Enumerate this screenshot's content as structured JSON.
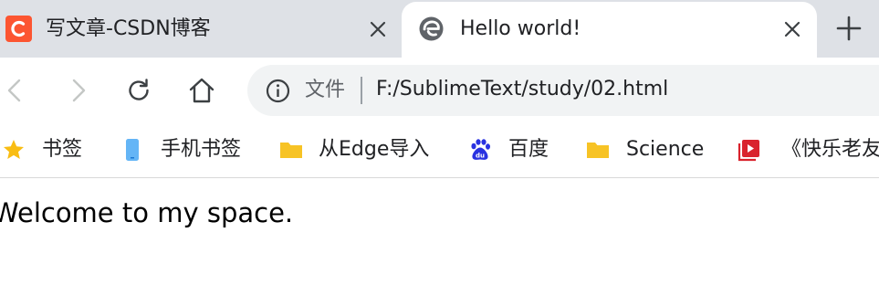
{
  "tabs": [
    {
      "title": "写文章-CSDN博客",
      "favicon": "csdn-logo-icon",
      "active": false
    },
    {
      "title": "Hello world!",
      "favicon": "edge-logo-icon",
      "active": true
    }
  ],
  "new_tab_icon": "plus-icon",
  "toolbar": {
    "back_icon": "back-arrow-icon",
    "forward_icon": "forward-arrow-icon",
    "reload_icon": "reload-icon",
    "home_icon": "home-icon"
  },
  "omnibox": {
    "info_icon": "info-icon",
    "secure_label": "文件",
    "url": "F:/SublimeText/study/02.html"
  },
  "bookmarks": [
    {
      "label": "书签",
      "icon": "star-icon"
    },
    {
      "label": "手机书签",
      "icon": "mobile-phone-icon"
    },
    {
      "label": "从Edge导入",
      "icon": "folder-icon"
    },
    {
      "label": "百度",
      "icon": "baidu-paw-icon"
    },
    {
      "label": "Science",
      "icon": "folder-icon"
    },
    {
      "label": "《快乐老友",
      "icon": "video-play-icon"
    }
  ],
  "page": {
    "text": "Welcome to my space."
  },
  "colors": {
    "tab_strip": "#dee1e6",
    "omnibox": "#f1f3f4",
    "csdn_brand": "#fc5531",
    "folder": "#f7c325",
    "baidu_blue": "#2932e1",
    "video_red": "#d9232d"
  }
}
